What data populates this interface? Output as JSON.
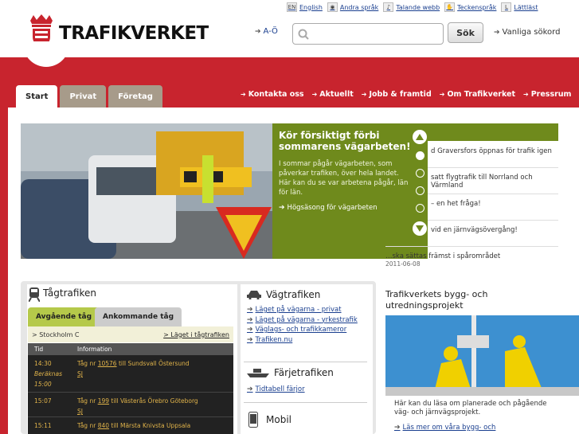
{
  "header": {
    "brand": "TRAFIKVERKET",
    "toplinks": [
      {
        "icon": "flag-en-icon",
        "label": "English",
        "mark": "EN"
      },
      {
        "icon": "globe-icon",
        "label": "Andra språk",
        "mark": "◉"
      },
      {
        "icon": "speaker-icon",
        "label": "Talande webb",
        "mark": "♪"
      },
      {
        "icon": "sign-language-icon",
        "label": "Teckenspråk",
        "mark": "✋"
      },
      {
        "icon": "easy-read-icon",
        "label": "Lättläst",
        "mark": "L"
      }
    ],
    "ao": "A-Ö",
    "search": {
      "placeholder": "",
      "button": "Sök"
    },
    "faq": "Vanliga sökord"
  },
  "tabs": [
    "Start",
    "Privat",
    "Företag"
  ],
  "topnav": [
    "Kontakta oss",
    "Aktuellt",
    "Jobb & framtid",
    "Om Trafikverket",
    "Pressrum"
  ],
  "hero": {
    "title": "Kör försiktigt förbi sommarens vägarbeten!",
    "text": "I sommar pågår vägarbeten, som påverkar trafiken, över hela landet. Här kan du se var arbetena pågår, län för län.",
    "link": "Högsäsong för vägarbeten",
    "slides": 5,
    "active_slide": 1
  },
  "news": [
    {
      "text": "d Graversfors öppnas för trafik igen"
    },
    {
      "text": "satt flygtrafik till Norrland och Värmland"
    },
    {
      "text": "– en het fråga!"
    },
    {
      "text": "vid en järnvägsövergång!"
    },
    {
      "text": "…ska sättas främst i spårområdet",
      "date": "2011-06-08"
    }
  ],
  "tag": {
    "title": "Tågtrafiken",
    "tab_departures": "Avgående tåg",
    "tab_arrivals": "Ankommande tåg",
    "station": "> Stockholm C",
    "status_link": "> Läget i tågtrafiken",
    "col_time": "Tid",
    "col_info": "Information",
    "rows": [
      {
        "time": "14:30",
        "note": "Beräknas",
        "note_time": "15:00",
        "prefix": "Tåg nr",
        "nr": "10576",
        "dest": "till Sundsvall Östersund",
        "op": "SJ"
      },
      {
        "time": "15:07",
        "prefix": "Tåg nr",
        "nr": "199",
        "dest": "till Västerås Örebro Göteborg",
        "op": "SJ"
      },
      {
        "time": "15:11",
        "prefix": "Tåg nr",
        "nr": "840",
        "dest": "till Märsta Knivsta Uppsala",
        "op": ""
      }
    ]
  },
  "vag": {
    "title": "Vägtrafiken",
    "links": [
      "Läget på vägarna - privat",
      "Läget på vägarna - yrkestrafik",
      "Väglags- och trafikkameror",
      "Trafiken.nu"
    ],
    "ferry_title": "Färjetrafiken",
    "ferry_link": "Tidtabell färjor",
    "mobile_title": "Mobil"
  },
  "project": {
    "title": "Trafikverkets bygg- och utredningsprojekt",
    "text": "Här kan du läsa om planerade och pågående väg- och järnvägsprojekt.",
    "link": "Läs mer om våra bygg- och"
  },
  "colors": {
    "red": "#c8242e",
    "green": "#6f8a1c",
    "tab_beige": "#a79b8a"
  }
}
